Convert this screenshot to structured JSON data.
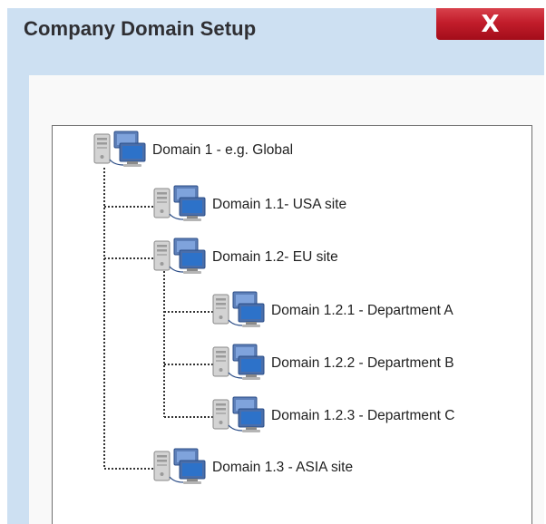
{
  "window": {
    "title": "Company Domain Setup",
    "close_label": "X",
    "close_color": "#c21d2b",
    "title_bar_color": "#cde0f2"
  },
  "tree": {
    "icon": "network-computers-icon",
    "nodes": [
      {
        "id": "d1",
        "label": "Domain 1 - e.g. Global",
        "level": 0
      },
      {
        "id": "d1-1",
        "label": "Domain 1.1- USA site",
        "level": 1
      },
      {
        "id": "d1-2",
        "label": "Domain 1.2- EU site",
        "level": 1
      },
      {
        "id": "d1-2-1",
        "label": "Domain 1.2.1 - Department A",
        "level": 2
      },
      {
        "id": "d1-2-2",
        "label": "Domain 1.2.2 - Department B",
        "level": 2
      },
      {
        "id": "d1-2-3",
        "label": "Domain 1.2.3 - Department C",
        "level": 2
      },
      {
        "id": "d1-3",
        "label": "Domain 1.3 - ASIA site",
        "level": 1
      }
    ]
  }
}
